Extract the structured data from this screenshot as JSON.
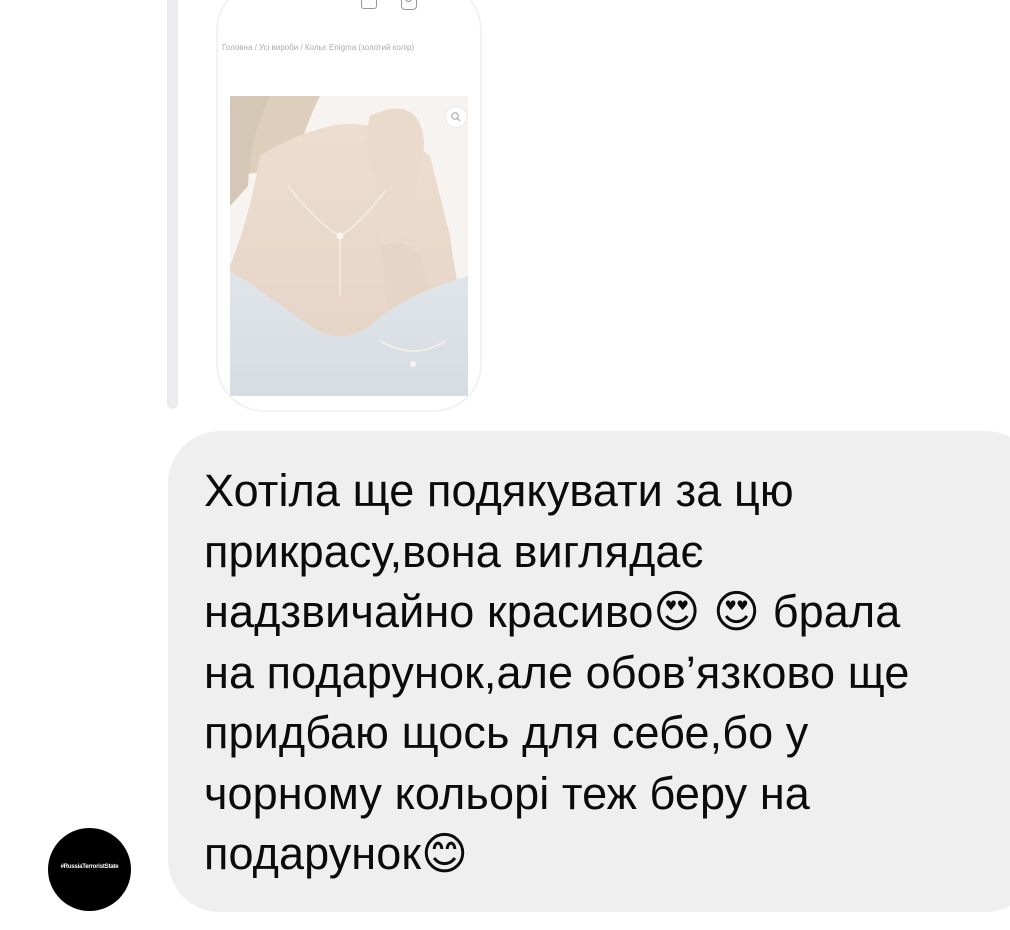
{
  "shared_post": {
    "breadcrumb": "Головна / Усі вироби / Кольє Enigma (золотий колір)",
    "zoom_icon": "magnifier-icon",
    "bag_icon": "shopping-bag-icon",
    "instagram_icon": "instagram-icon"
  },
  "message": {
    "text": "Хотіла ще подякувати за цю\nприкрасу,вона виглядає\nнадзвичайно красиво😍 😍  брала\nна подарунок,але обов’язково ще\nпридбаю щось для себе,бо у\nчорному кольорі теж беру на\nподарунок😊"
  },
  "sender": {
    "avatar_label": "#RussiaTerroristState"
  },
  "colors": {
    "bubble": "#efefef",
    "text": "#0b0b0b",
    "reply_bar": "#ececee",
    "avatar": "#000000"
  }
}
